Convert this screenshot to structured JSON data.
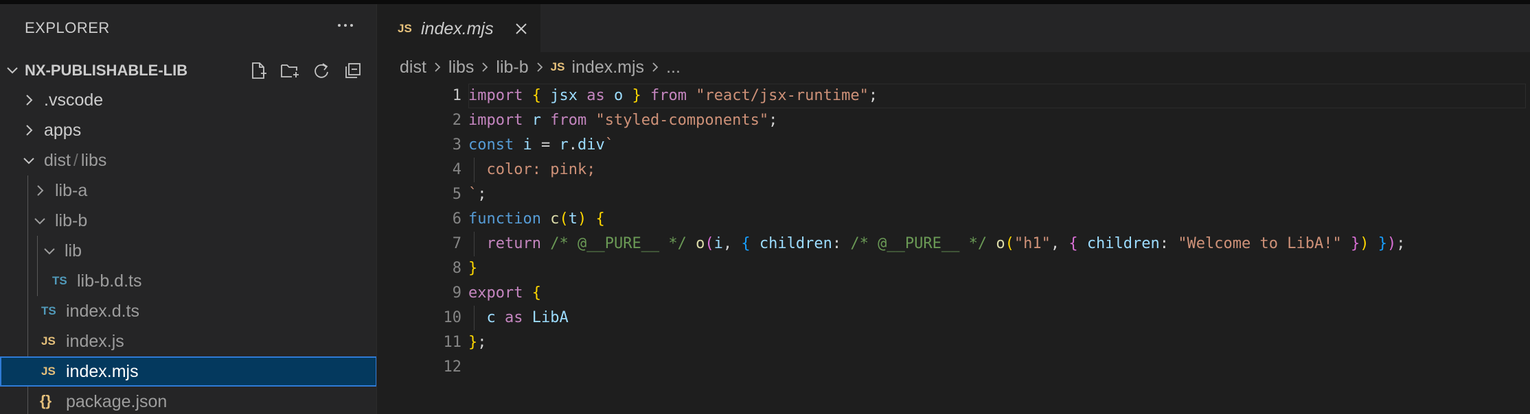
{
  "sidebar": {
    "title": "EXPLORER",
    "project": "NX-PUBLISHABLE-LIB",
    "items": [
      {
        "label": ".vscode"
      },
      {
        "label": "apps"
      },
      {
        "label": "dist",
        "label2": "libs"
      },
      {
        "label": "lib-a"
      },
      {
        "label": "lib-b"
      },
      {
        "label": "lib"
      },
      {
        "label": "lib-b.d.ts",
        "badge": "TS"
      },
      {
        "label": "index.d.ts",
        "badge": "TS"
      },
      {
        "label": "index.js",
        "badge": "JS"
      },
      {
        "label": "index.mjs",
        "badge": "JS"
      },
      {
        "label": "package.json",
        "badge": "{}"
      }
    ]
  },
  "tab": {
    "badge": "JS",
    "label": "index.mjs"
  },
  "breadcrumb": {
    "items": [
      "dist",
      "libs",
      "lib-b",
      "index.mjs",
      "..."
    ],
    "js_badge": "JS"
  },
  "editor": {
    "line_numbers": [
      "1",
      "2",
      "3",
      "4",
      "5",
      "6",
      "7",
      "8",
      "9",
      "10",
      "11",
      "12"
    ],
    "lines": [
      [
        "import",
        " ",
        "{",
        " ",
        "jsx",
        " ",
        "as",
        " ",
        "o",
        " ",
        "}",
        " ",
        "from",
        " ",
        "\"react/jsx-runtime\"",
        ";"
      ],
      [
        "import",
        " ",
        "r",
        " ",
        "from",
        " ",
        "\"styled-components\"",
        ";"
      ],
      [
        "const",
        " ",
        "i",
        " = ",
        "r",
        ".",
        "div",
        "`"
      ],
      [
        "  color: pink;"
      ],
      [
        "`",
        ";"
      ],
      [
        "function",
        " ",
        "c",
        "(",
        "t",
        ")",
        " ",
        "{"
      ],
      [
        "  ",
        "return",
        " ",
        "/* @__PURE__ */",
        " ",
        "o",
        "(",
        "i",
        ", ",
        "{",
        " ",
        "children",
        ": ",
        "/* @__PURE__ */",
        " ",
        "o",
        "(",
        "\"h1\"",
        ", ",
        "{",
        " ",
        "children",
        ": ",
        "\"Welcome to LibA!\"",
        " ",
        "}",
        ")",
        " ",
        "}",
        ")",
        ";"
      ],
      [
        "}"
      ],
      [
        "export",
        " ",
        "{"
      ],
      [
        "  ",
        "c",
        " ",
        "as",
        " ",
        "LibA"
      ],
      [
        "}",
        ";"
      ],
      [
        ""
      ]
    ]
  }
}
